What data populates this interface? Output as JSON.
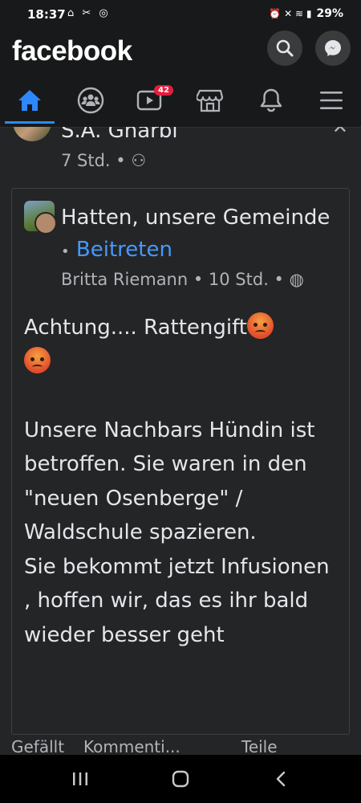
{
  "status": {
    "time": "18:37",
    "left_icons": "⌂ ✂ ◎",
    "right_icons": "⏰ ✕ ≋ ▮",
    "battery": "29%"
  },
  "app": {
    "logo": "facebook",
    "nav_badge": "42",
    "accent": "#2d88ff"
  },
  "post": {
    "author": "S.A. Gharbi",
    "meta": "7 Std. • ⚇",
    "shared": {
      "group_name": "Hatten, unsere Gemeinde",
      "separator": "•",
      "join_label": "Beitreten",
      "meta": "Britta Riemann • 10 Std. • ◍",
      "body_line1": "Achtung.... Rattengift",
      "body_rest": "Unsere Nachbars Hündin ist betroffen. Sie waren in den \"neuen Osenberge\" / Waldschule spazieren.\nSie bekommt jetzt Infusionen , hoffen wir, das es ihr bald wieder besser geht"
    },
    "actions": {
      "like": "Gefällt",
      "comment": "Kommenti...",
      "share": "Teile"
    }
  },
  "icons": {
    "search": "search-icon",
    "messenger": "messenger-icon",
    "home": "home-icon",
    "groups": "groups-icon",
    "watch": "watch-icon",
    "marketplace": "marketplace-icon",
    "notifications": "bell-icon",
    "menu": "menu-icon"
  }
}
